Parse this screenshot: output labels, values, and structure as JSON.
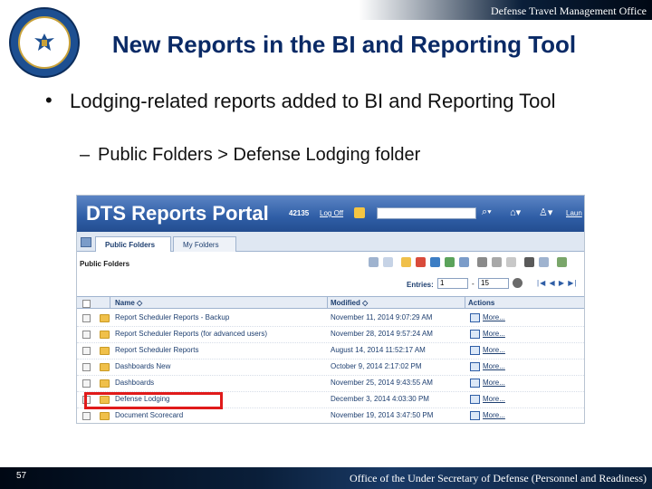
{
  "slide": {
    "org_top": "Defense Travel Management Office",
    "title": "New Reports in the BI and Reporting Tool",
    "bullet1": "Lodging-related reports added to BI and Reporting Tool",
    "bullet1_marker": "•",
    "bullet2": "Public Folders > Defense Lodging folder",
    "bullet2_marker": "–",
    "page_number": "57",
    "org_bottom": "Office of the Under Secretary of Defense (Personnel and Readiness)",
    "seal_icon": "dod-seal-icon"
  },
  "portal": {
    "title": "DTS Reports Portal",
    "user_id": "42135",
    "logoff": "Log Off",
    "launch": "Laun",
    "tabs": [
      "Public Folders",
      "My Folders"
    ],
    "section_label": "Public Folders",
    "entries_label": "Entries:",
    "entries_from": "1",
    "entries_dash": "-",
    "entries_to": "15",
    "pager": "|◀ ◀ ▶ ▶|",
    "columns": {
      "name": "Name ◇",
      "modified": "Modified ◇",
      "actions": "Actions"
    },
    "rows": [
      {
        "name": "Report Scheduler Reports - Backup",
        "modified": "November 11, 2014 9:07:29 AM",
        "action": "More..."
      },
      {
        "name": "Report Scheduler Reports (for advanced users)",
        "modified": "November 28, 2014 9:57:24 AM",
        "action": "More..."
      },
      {
        "name": "Report Scheduler Reports",
        "modified": "August 14, 2014 11:52:17 AM",
        "action": "More..."
      },
      {
        "name": "Dashboards New",
        "modified": "October 9, 2014 2:17:02 PM",
        "action": "More..."
      },
      {
        "name": "Dashboards",
        "modified": "November 25, 2014 9:43:55 AM",
        "action": "More..."
      },
      {
        "name": "Defense Lodging",
        "modified": "December 3, 2014 4:03:30 PM",
        "action": "More..."
      },
      {
        "name": "Document Scorecard",
        "modified": "November 19, 2014 3:47:50 PM",
        "action": "More..."
      }
    ],
    "highlighted_row": "Defense Lodging",
    "colors": {
      "header_blue": "#2f5ea6",
      "highlight_red": "#e01a1a",
      "title_navy": "#0a2a66"
    }
  }
}
